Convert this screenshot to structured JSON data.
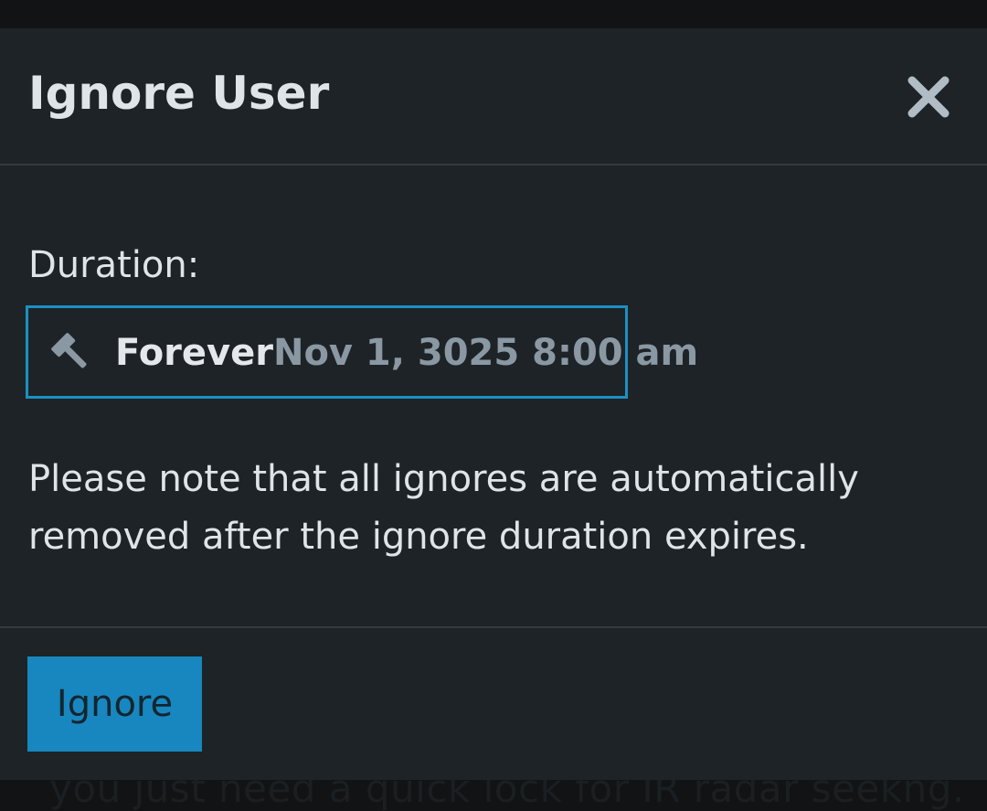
{
  "background": {
    "partial_text": "you just need a quick lock for IR radar seekng."
  },
  "dialog": {
    "title": "Ignore User",
    "close_icon": "close-icon",
    "duration_label": "Duration:",
    "duration_select": {
      "icon": "gavel-icon",
      "selected": "Forever",
      "date": "Nov 1, 3025 8:00 am"
    },
    "note_lines": [
      "Please note that all ignores are automatically",
      "removed after the ignore duration expires."
    ],
    "submit_label": "Ignore"
  },
  "colors": {
    "dialog_bg": "#1e2327",
    "accent": "#1887bf",
    "text": "#dfe4e8",
    "muted": "#8a98a3"
  }
}
